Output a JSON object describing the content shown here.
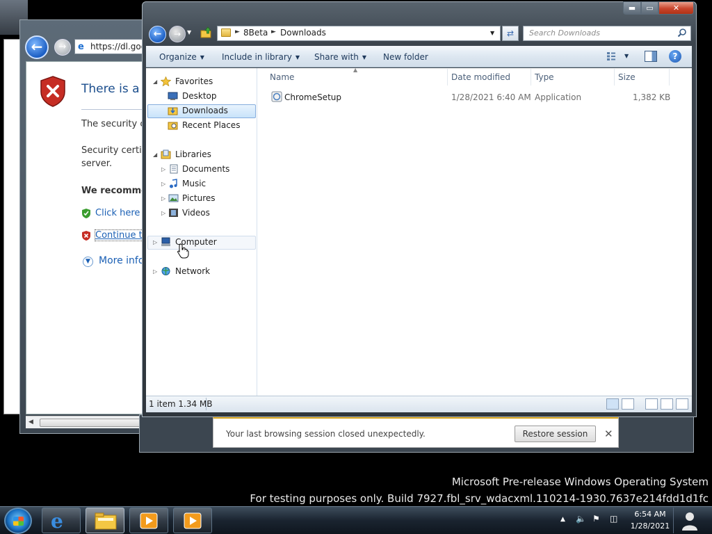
{
  "ie": {
    "address": "https://dl.goog",
    "heading": "There is a p",
    "line1": "The security ce",
    "line2a": "Security certific",
    "line2b": "server.",
    "recommend": "We recommen",
    "link_close": "Click here to",
    "link_continue": "Continue to",
    "more_info": "More info"
  },
  "notification": {
    "message": "Your last browsing session closed unexpectedly.",
    "restore_label": "Restore session",
    "close_glyph": "✕"
  },
  "explorer": {
    "caption": {
      "min": "▬",
      "max": "▭",
      "close": "✕"
    },
    "breadcrumb": [
      "8Beta",
      "Downloads"
    ],
    "search_placeholder": "Search Downloads",
    "commands": {
      "organize": "Organize",
      "include": "Include in library",
      "share": "Share with",
      "new_folder": "New folder"
    },
    "nav": {
      "favorites": "Favorites",
      "desktop": "Desktop",
      "downloads": "Downloads",
      "recent": "Recent Places",
      "libraries": "Libraries",
      "documents": "Documents",
      "music": "Music",
      "pictures": "Pictures",
      "videos": "Videos",
      "computer": "Computer",
      "network": "Network"
    },
    "columns": {
      "name": "Name",
      "date": "Date modified",
      "type": "Type",
      "size": "Size"
    },
    "files": [
      {
        "name": "ChromeSetup",
        "date": "1/28/2021 6:40 AM",
        "type": "Application",
        "size": "1,382 KB"
      }
    ],
    "status": "1 item 1.34 MB"
  },
  "desktop": {
    "watermark_line1": "Microsoft Pre-release Windows Operating System",
    "watermark_line2": "For testing purposes only. Build 7927.fbl_srv_wdacxml.110214-1930.7637e214fdd1d1fc"
  },
  "taskbar": {
    "time": "6:54 AM",
    "date": "1/28/2021"
  },
  "colors": {
    "accent_blue": "#1c5fc4",
    "selection": "#c8e3fa",
    "close_red": "#c8452c",
    "link": "#1a5fb4"
  }
}
